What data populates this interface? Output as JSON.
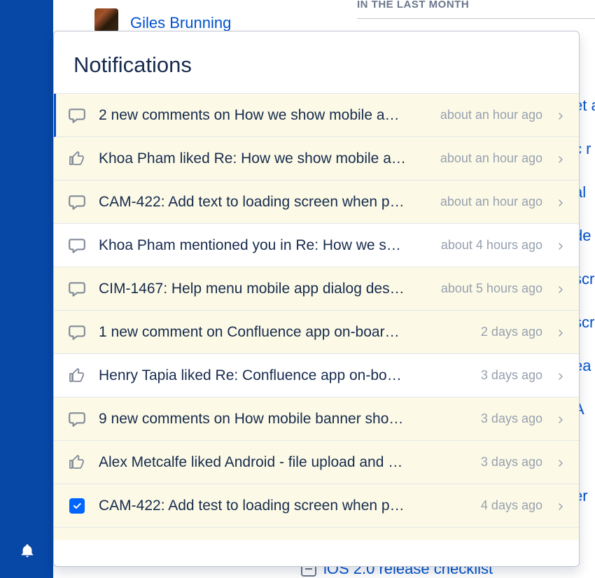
{
  "background": {
    "section_header": "IN THE LAST MONTH",
    "user_name": "Giles Brunning",
    "right_links": [
      "et a",
      "c r",
      "al",
      "de",
      "scr",
      "scr",
      "ea",
      "A",
      "",
      "er"
    ],
    "bottom_link": "iOS 2.0 release checklist"
  },
  "panel": {
    "title": "Notifications"
  },
  "notifications": [
    {
      "icon": "comment",
      "text": "2 new comments on How we show mobile a…",
      "time": "about an hour ago",
      "unread": true
    },
    {
      "icon": "like",
      "text": "Khoa Pham liked Re: How we show mobile a…",
      "time": "about an hour ago",
      "unread": true
    },
    {
      "icon": "comment",
      "text": "CAM-422: Add text to loading screen when p…",
      "time": "about an hour ago",
      "unread": true
    },
    {
      "icon": "comment",
      "text": "Khoa Pham mentioned you in Re: How we s…",
      "time": "about 4 hours ago",
      "unread": false
    },
    {
      "icon": "comment",
      "text": "CIM-1467: Help menu mobile app dialog des…",
      "time": "about 5 hours ago",
      "unread": true
    },
    {
      "icon": "comment",
      "text": "1 new comment on Confluence app on-boar…",
      "time": "2 days ago",
      "unread": true
    },
    {
      "icon": "like",
      "text": "Henry Tapia liked Re: Confluence app on-bo…",
      "time": "3 days ago",
      "unread": false
    },
    {
      "icon": "comment",
      "text": "9 new comments on How mobile banner sho…",
      "time": "3 days ago",
      "unread": true
    },
    {
      "icon": "like",
      "text": "Alex Metcalfe liked Android - file upload and …",
      "time": "3 days ago",
      "unread": true
    },
    {
      "icon": "task-done",
      "text": "CAM-422: Add test to loading screen when p…",
      "time": "4 days ago",
      "unread": true
    }
  ]
}
